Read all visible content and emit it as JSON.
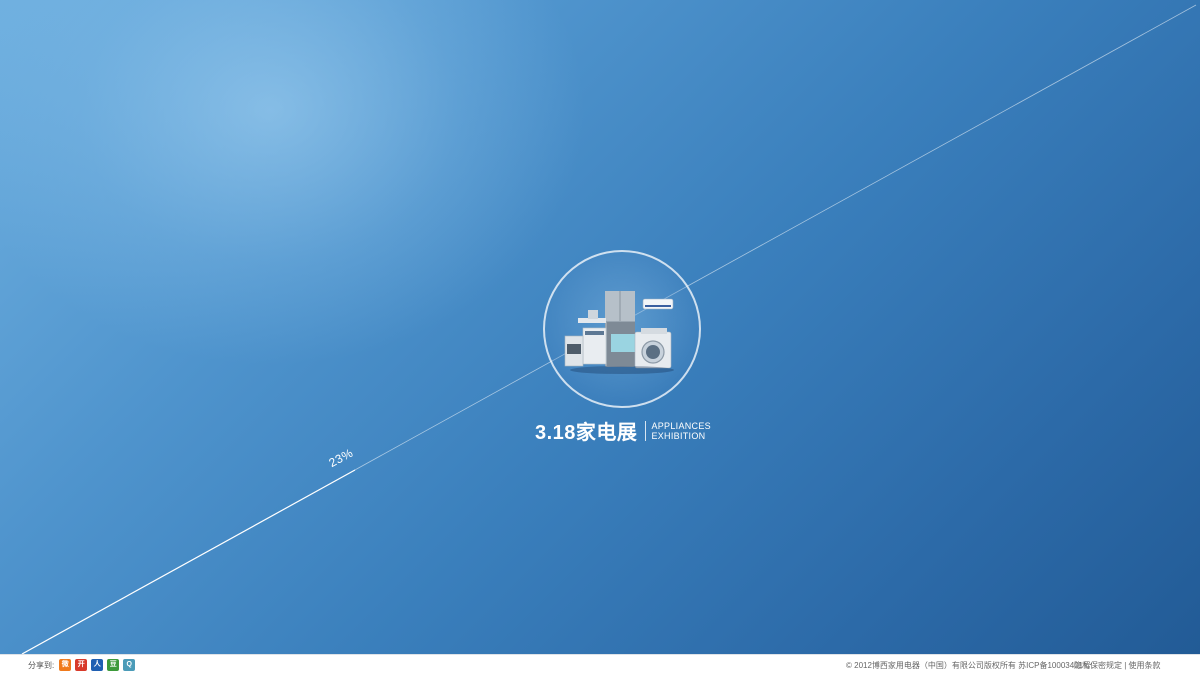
{
  "progress": {
    "label": "23%",
    "value": 0.23
  },
  "event": {
    "title": "3.18家电展",
    "subtitle_line1": "APPLIANCES",
    "subtitle_line2": "EXHIBITION"
  },
  "footer": {
    "share_label": "分享到:",
    "share_buttons": [
      {
        "label": "微",
        "color": "#f07a1c"
      },
      {
        "label": "开",
        "color": "#d83a2a"
      },
      {
        "label": "人",
        "color": "#1f5fb2"
      },
      {
        "label": "豆",
        "color": "#3d9a3a"
      },
      {
        "label": "Q",
        "color": "#4b9bb8"
      }
    ],
    "copyright": "© 2012博西家用电器（中国）有限公司版权所有 苏ICP备10003401号.",
    "privacy_link": "隐私保密规定",
    "separator": "|",
    "terms_link": "使用条款"
  },
  "colors": {
    "background_top": "#6fb0e0",
    "background_bottom": "#225b96",
    "line": "#ffffff"
  }
}
